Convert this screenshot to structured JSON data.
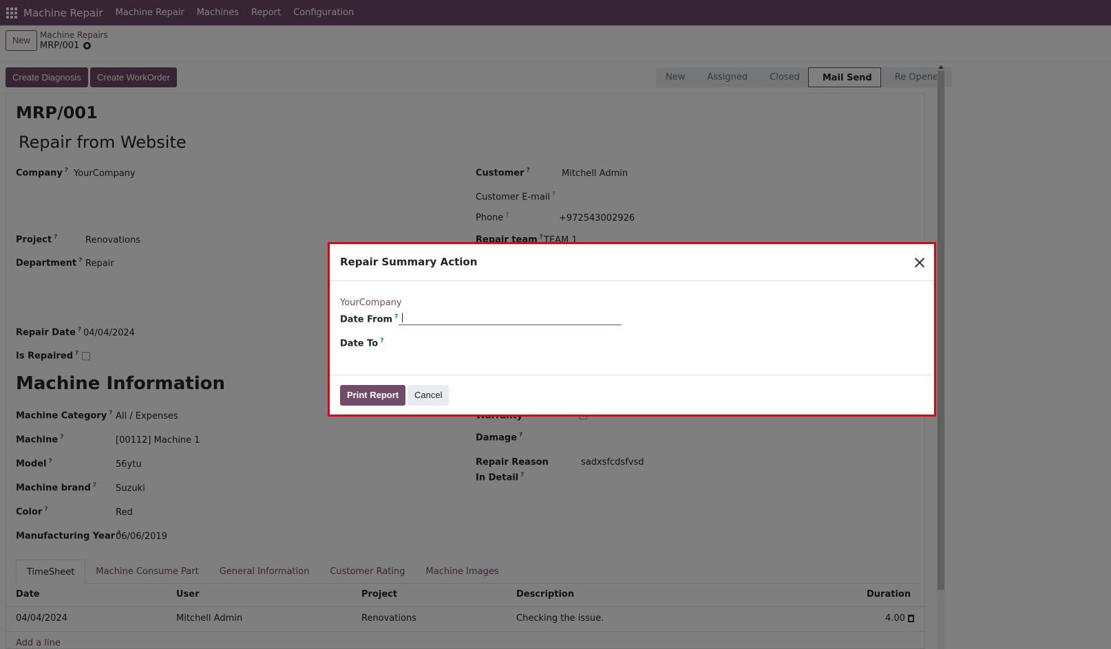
{
  "navbar": {
    "app_name": "Machine Repair",
    "menu": [
      "Machine Repair",
      "Machines",
      "Report",
      "Configuration"
    ]
  },
  "control": {
    "new_label": "New",
    "breadcrumb_parent": "Machine Repairs",
    "breadcrumb_current": "MRP/001"
  },
  "actions": {
    "create_diagnosis": "Create Diagnosis",
    "create_workorder": "Create WorkOrder"
  },
  "statusbar": {
    "stages": [
      "New",
      "Assigned",
      "Closed",
      "Mail Send",
      "Re Opened"
    ],
    "active": "Mail Send"
  },
  "form": {
    "reference": "MRP/001",
    "name": "Repair from Website",
    "left_fields": [
      {
        "label": "Company",
        "value": "YourCompany"
      },
      {
        "label": "Project",
        "value": "Renovations"
      },
      {
        "label": "Department",
        "value": "Repair"
      },
      {
        "label": "Repair Date",
        "value": "04/04/2024"
      },
      {
        "label": "Is Repaired",
        "value": ""
      }
    ],
    "right_fields": [
      {
        "label": "Customer",
        "value": "Mitchell Admin"
      },
      {
        "label": "Customer E-mail",
        "value": ""
      },
      {
        "label": "Phone",
        "value": "+972543002926"
      },
      {
        "label": "Repair team",
        "value": "TEAM 1"
      }
    ],
    "machine_section_title": "Machine Information",
    "machine_fields": [
      {
        "label": "Machine Category",
        "value": "All / Expenses"
      },
      {
        "label": "Machine",
        "value": "[00112] Machine 1"
      },
      {
        "label": "Model",
        "value": "56ytu"
      },
      {
        "label": "Machine brand",
        "value": "Suzuki"
      },
      {
        "label": "Color",
        "value": "Red"
      },
      {
        "label": "Manufacturing Year",
        "value": "06/06/2019"
      }
    ],
    "machine_right_fields": [
      {
        "label": "Warranty",
        "value": ""
      },
      {
        "label": "Damage",
        "value": ""
      },
      {
        "label": "Repair Reason In Detail",
        "value": "sadxsfcdsfvsd"
      }
    ],
    "help_mark": "?"
  },
  "tabs": [
    "TimeSheet",
    "Machine Consume Part",
    "General Information",
    "Customer Rating",
    "Machine Images"
  ],
  "timesheet": {
    "columns": [
      "Date",
      "User",
      "Project",
      "Description",
      "Duration"
    ],
    "rows": [
      {
        "date": "04/04/2024",
        "user": "Mitchell Admin",
        "project": "Renovations",
        "description": "Checking the issue.",
        "duration": "4.00"
      }
    ],
    "add_line": "Add a line"
  },
  "dialog": {
    "title": "Repair Summary Action",
    "company": "YourCompany",
    "date_from_label": "Date From",
    "date_to_label": "Date To",
    "date_from_value": "",
    "print_label": "Print Report",
    "cancel_label": "Cancel"
  },
  "colors": {
    "brand": "#714b67",
    "highlight_border": "#e3000f"
  }
}
